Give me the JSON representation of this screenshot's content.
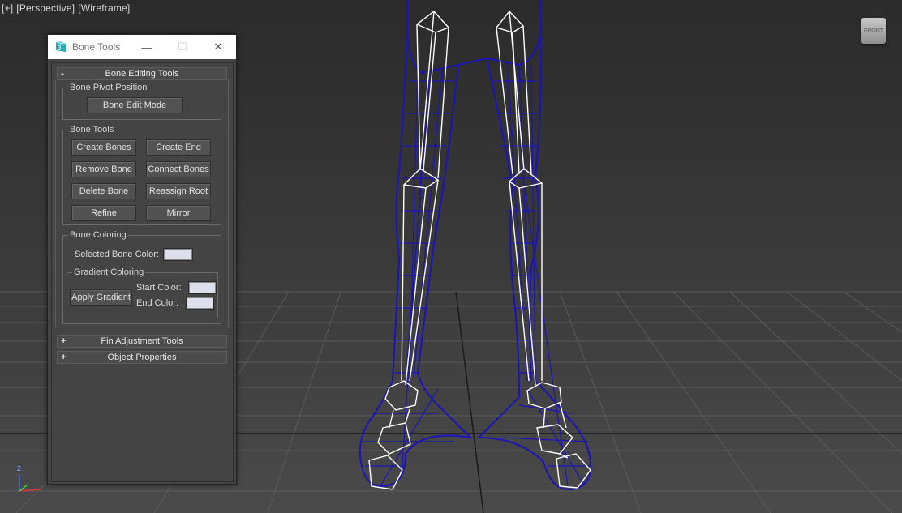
{
  "viewport": {
    "labels": [
      "[+]",
      "[Perspective]",
      "[Wireframe]"
    ],
    "viewcube_label": "FRONT",
    "axis_labels": {
      "z": "Z"
    }
  },
  "dialog": {
    "title": "Bone Tools",
    "window_buttons": {
      "minimize": "—",
      "maximize": "☐",
      "close": "✕"
    },
    "rollouts": {
      "bone_editing": {
        "sign": "-",
        "title": "Bone Editing Tools",
        "pivot_group": {
          "label": "Bone Pivot Position",
          "edit_mode_button": "Bone Edit Mode"
        },
        "tools_group": {
          "label": "Bone Tools",
          "buttons": [
            "Create Bones",
            "Create End",
            "Remove Bone",
            "Connect Bones",
            "Delete Bone",
            "Reassign Root",
            "Refine",
            "Mirror"
          ]
        },
        "coloring_group": {
          "label": "Bone Coloring",
          "selected_color_label": "Selected Bone Color:",
          "gradient": {
            "label": "Gradient Coloring",
            "apply_button": "Apply Gradient",
            "start_label": "Start Color:",
            "end_label": "End Color:"
          }
        }
      },
      "fin_adjustment": {
        "sign": "+",
        "title": "Fin Adjustment Tools"
      },
      "object_properties": {
        "sign": "+",
        "title": "Object Properties"
      }
    }
  },
  "colors": {
    "wireframe": "#1a14b8",
    "bones": "#ffffff",
    "swatch": "#dde0ec",
    "grid": "#5a5a5a"
  }
}
